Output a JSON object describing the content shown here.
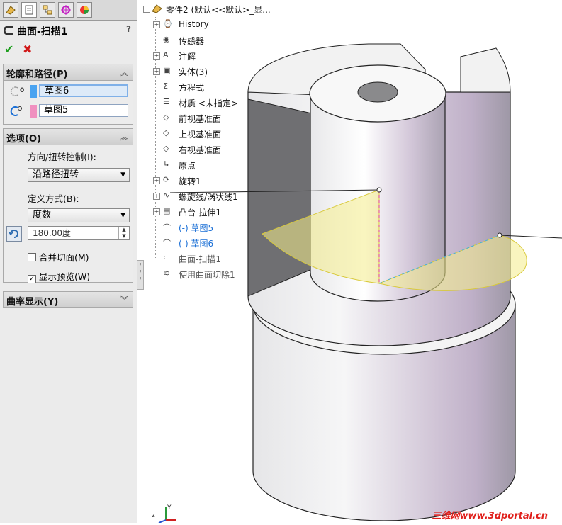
{
  "property_manager": {
    "tabs": [
      "feature-manager-tab",
      "property-manager-tab",
      "configuration-manager-tab",
      "dimxpert-tab",
      "display-manager-tab"
    ],
    "feature_title": "曲面-扫描1",
    "help": "?",
    "ok_icon": "checkmark-icon",
    "cancel_icon": "close-icon",
    "profile_group": {
      "title": "轮廓和路径(P)",
      "profile_value": "草图6",
      "profile_color": "#4aa3f0",
      "path_value": "草图5",
      "path_color": "#f090c0"
    },
    "options_group": {
      "title": "选项(O)",
      "orientation_label": "方向/扭转控制(I):",
      "orientation_value": "沿路径扭转",
      "define_label": "定义方式(B):",
      "define_value": "度数",
      "angle_value": "180.00度",
      "merge_faces_label": "合并切面(M)",
      "merge_faces_checked": false,
      "show_preview_label": "显示预览(W)",
      "show_preview_checked": true
    },
    "curvature_group": {
      "title": "曲率显示(Y)"
    }
  },
  "feature_tree": {
    "root": "零件2 (默认<<默认>_显...",
    "items": [
      {
        "label": "History",
        "icon": "history-icon"
      },
      {
        "label": "传感器",
        "icon": "sensor-icon"
      },
      {
        "label": "注解",
        "icon": "annotation-icon"
      },
      {
        "label": "实体(3)",
        "icon": "solid-bodies-icon"
      },
      {
        "label": "方程式",
        "icon": "equation-icon"
      },
      {
        "label": "材质 <未指定>",
        "icon": "material-icon"
      },
      {
        "label": "前视基准面",
        "icon": "plane-icon"
      },
      {
        "label": "上视基准面",
        "icon": "plane-icon"
      },
      {
        "label": "右视基准面",
        "icon": "plane-icon"
      },
      {
        "label": "原点",
        "icon": "origin-icon"
      },
      {
        "label": "旋转1",
        "icon": "revolve-icon"
      },
      {
        "label": "螺旋线/涡状线1",
        "icon": "helix-icon"
      },
      {
        "label": "凸台-拉伸1",
        "icon": "extrude-icon"
      },
      {
        "label": "(-) 草图5",
        "icon": "sketch-icon"
      },
      {
        "label": "(-) 草图6",
        "icon": "sketch-icon"
      },
      {
        "label": "曲面-扫描1",
        "icon": "sweep-surface-icon"
      },
      {
        "label": "使用曲面切除1",
        "icon": "surface-cut-icon"
      }
    ]
  },
  "viewport": {
    "model": "cylinder-with-sweep-preview",
    "watermark": "三维网www.3dportal.cn"
  }
}
